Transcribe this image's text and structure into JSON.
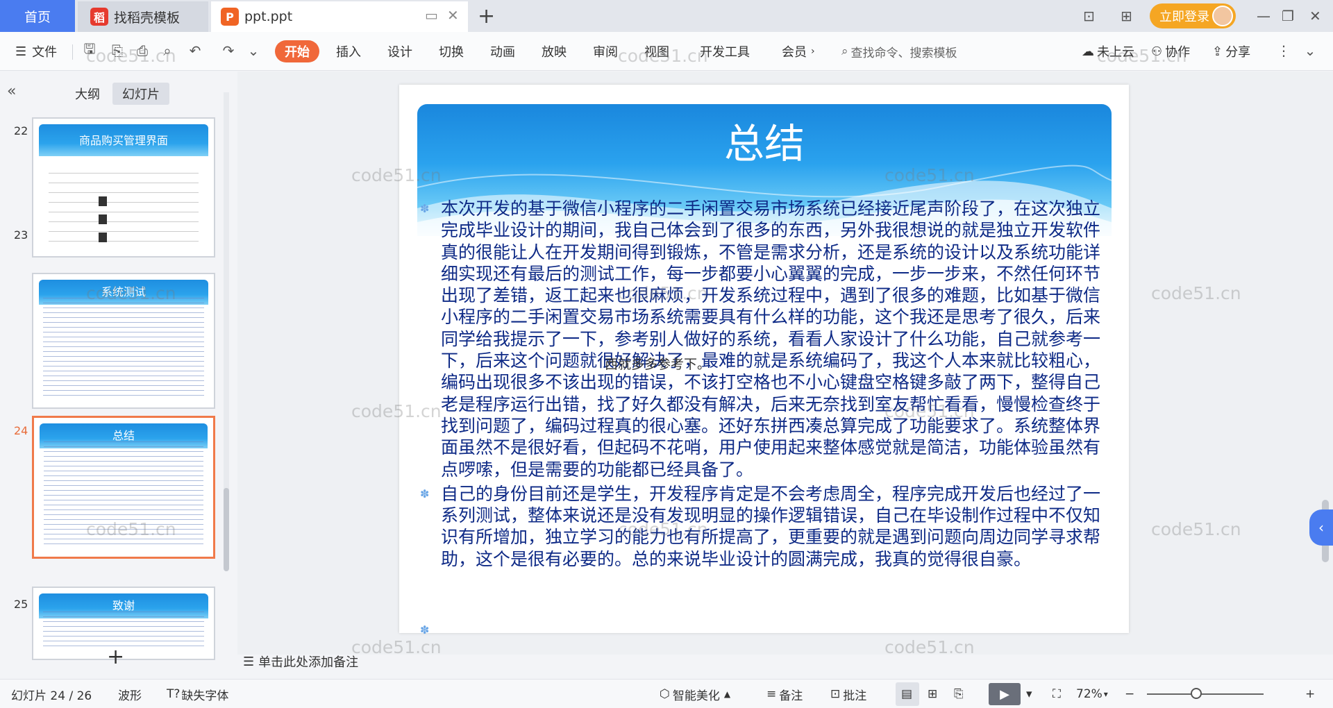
{
  "titlebar": {
    "home_tab": "首页",
    "tab_templates": "找稻壳模板",
    "tab_file": "ppt.ppt",
    "login_label": "立即登录"
  },
  "toolbar": {
    "file_menu": "文件",
    "tabs": [
      "开始",
      "插入",
      "设计",
      "切换",
      "动画",
      "放映",
      "审阅",
      "视图",
      "开发工具",
      "会员"
    ],
    "search_placeholder": "查找命令、搜索模板",
    "cloud_status": "未上云",
    "collaborate": "协作",
    "share": "分享"
  },
  "left_panel": {
    "tab_outline": "大纲",
    "tab_slides": "幻灯片",
    "thumbnails": [
      {
        "number": "22",
        "title": "商品购买管理界面"
      },
      {
        "number": "23",
        "title": "系统测试"
      },
      {
        "number": "24",
        "title": "总结"
      },
      {
        "number": "25",
        "title": "致谢"
      }
    ]
  },
  "slide": {
    "title": "总结",
    "paragraphs": [
      "本次开发的基于微信小程序的二手闲置交易市场系统已经接近尾声阶段了，在这次独立完成毕业设计的期间，我自己体会到了很多的东西，另外我很想说的就是独立开发软件真的很能让人在开发期间得到锻炼，不管是需求分析，还是系统的设计以及系统功能详细实现还有最后的测试工作，每一步都要小心翼翼的完成，一步一步来，不然任何环节出现了差错，返工起来也很麻烦，开发系统过程中，遇到了很多的难题，比如基于微信小程序的二手闲置交易市场系统需要具有什么样的功能，这个我还是思考了很久，后来同学给我提示了一下，参考别人做好的系统，看看人家设计了什么功能，自己就参考一下，后来这个问题就很好解决了，最难的就是系统编码了，我这个人本来就比较粗心，编码出现很多不该出现的错误，不该打空格也不小心键盘空格键多敲了两下，整得自己老是程序运行出错，找了好久都没有解决，后来无奈找到室友帮忙看看，慢慢检查终于找到问题了，编码过程真的很心塞。还好东拼西凑总算完成了功能要求了。系统整体界面虽然不是很好看，但起码不花哨，用户使用起来整体感觉就是简洁，功能体验虽然有点啰嗦，但是需要的功能都已经具备了。",
      "自己的身份目前还是学生，开发程序肯定是不会考虑周全，程序完成开发后也经过了一系列测试，整体来说还是没有发现明显的操作逻辑错误，自己在毕设制作过程中不仅知识有所增加，独立学习的能力也有所提高了，更重要的就是遇到问题向周边同学寻求帮助，这个是很有必要的。总的来说毕业设计的圆满完成，我真的觉得很自豪。"
    ],
    "overlay_text": "西就多多参考下。"
  },
  "notes_placeholder": "单击此处添加备注",
  "statusbar": {
    "slide_counter": "幻灯片 24 / 26",
    "theme": "波形",
    "missing_font": "缺失字体",
    "beautify": "智能美化",
    "notes": "备注",
    "comments": "批注",
    "zoom": "72%"
  },
  "watermark": "code51.cn"
}
